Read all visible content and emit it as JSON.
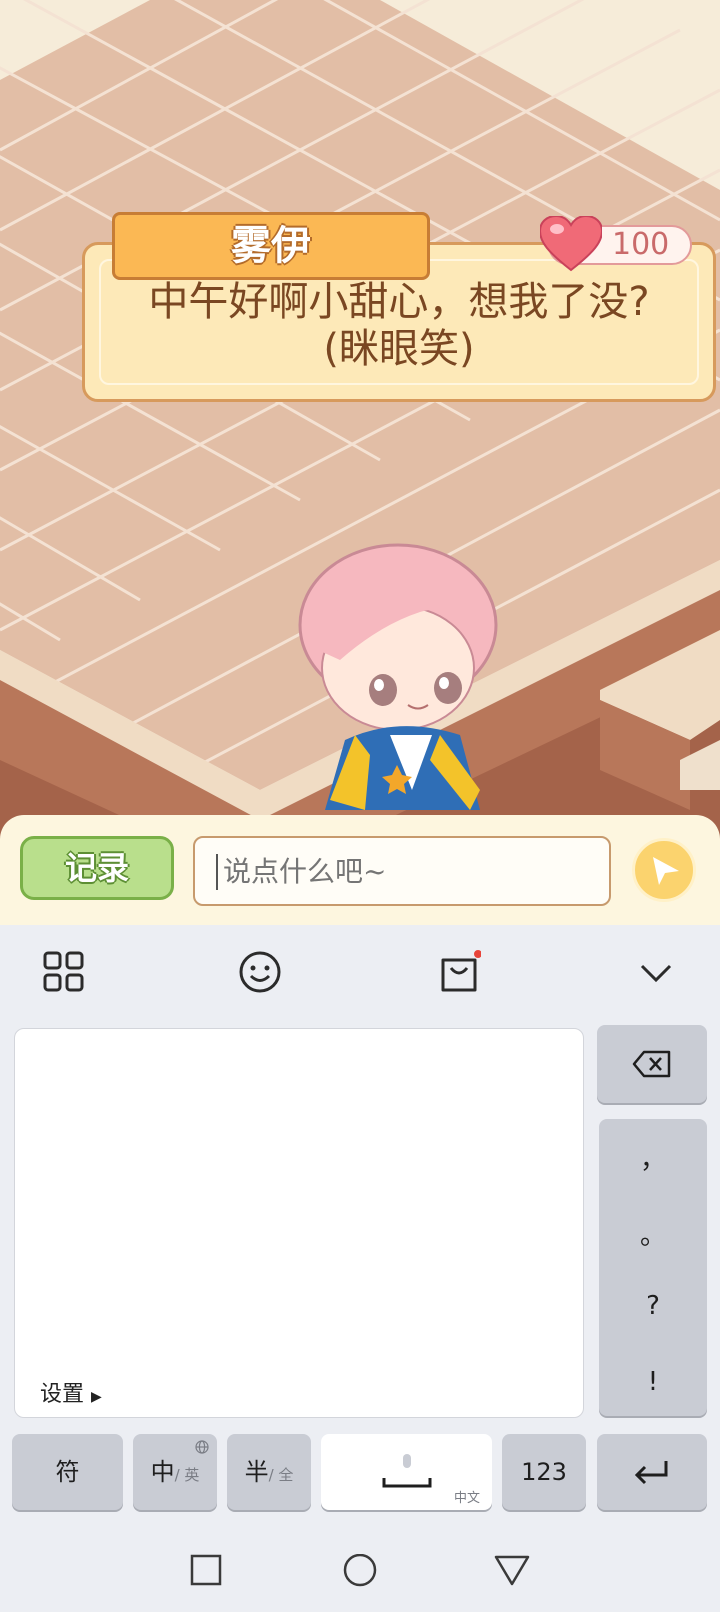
{
  "dialog": {
    "speaker": "雾伊",
    "line1": "中午好啊小甜心，想我了没?",
    "line2": "(眯眼笑)",
    "affection": "100"
  },
  "chatbar": {
    "record_label": "记录",
    "input_placeholder": "说点什么吧~"
  },
  "keyboard": {
    "toolbar_icons": [
      "grid-icon",
      "emoji-icon",
      "shop-bag-icon",
      "collapse-chevron-icon"
    ],
    "settings_label": "设置",
    "punctuation": [
      "，",
      "。",
      "?",
      "!"
    ],
    "keys": {
      "symbols": "符",
      "chinese": "中",
      "english_sub": "/ 英",
      "half": "半",
      "full_sub": "/ 全",
      "space_sub": "中文",
      "numbers": "123"
    }
  },
  "nav": [
    "recent-apps-icon",
    "home-icon",
    "back-icon"
  ],
  "colors": {
    "dialog_bg": "#fde9b8",
    "nameplate": "#fbb854",
    "record_button": "#b9df8c",
    "send_button": "#fbd36e",
    "keyboard_bg": "#eceef3",
    "key_gray": "#c9ccd4"
  }
}
